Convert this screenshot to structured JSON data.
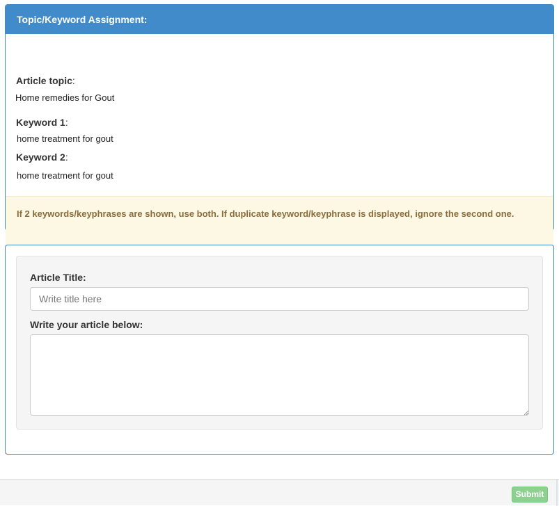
{
  "assignment": {
    "heading": "Topic/Keyword Assignment:",
    "topic_label": "Article topic",
    "topic_value": "Home remedies for Gout",
    "keyword1_label": "Keyword 1",
    "keyword1_value": "home treatment for gout",
    "keyword2_label": "Keyword 2",
    "keyword2_value": "home treatment for gout",
    "label_colon": ":",
    "notice": "If 2 keywords/keyphrases are shown, use both. If duplicate keyword/keyphrase is displayed, ignore the second one."
  },
  "article_form": {
    "title_label": "Article Title:",
    "title_placeholder": "Write title here",
    "title_value": "",
    "body_label": "Write your article below:",
    "body_value": ""
  },
  "footer": {
    "submit_label": "Submit"
  },
  "colors": {
    "heading_bg": "#428bca",
    "alert_bg": "#fcf8e3",
    "alert_text": "#8a6d3b",
    "submit_bg": "#8dd18f"
  }
}
